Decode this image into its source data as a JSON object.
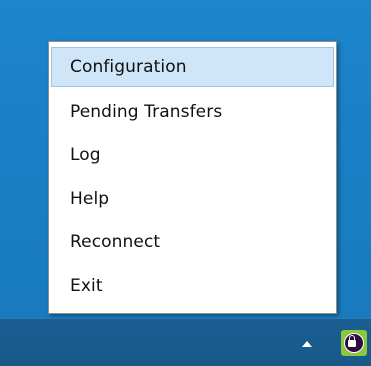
{
  "context_menu": {
    "items": [
      {
        "label": "Configuration",
        "highlighted": true
      },
      {
        "label": "Pending Transfers",
        "highlighted": false
      },
      {
        "label": "Log",
        "highlighted": false
      },
      {
        "label": "Help",
        "highlighted": false
      },
      {
        "label": "Reconnect",
        "highlighted": false
      },
      {
        "label": "Exit",
        "highlighted": false
      }
    ]
  },
  "taskbar": {
    "tray_icons": [
      {
        "icon": "show-hidden-icons-arrow-icon"
      },
      {
        "icon": "lock-app-tray-icon"
      }
    ]
  },
  "colors": {
    "desktop_background": "#1a80c6",
    "taskbar_background": "#175989",
    "menu_highlight": "#cfe5f8",
    "menu_highlight_border": "#9bc5ec",
    "tray_icon_green": "#8dc63f",
    "tray_icon_dark": "#2d0a3f"
  }
}
